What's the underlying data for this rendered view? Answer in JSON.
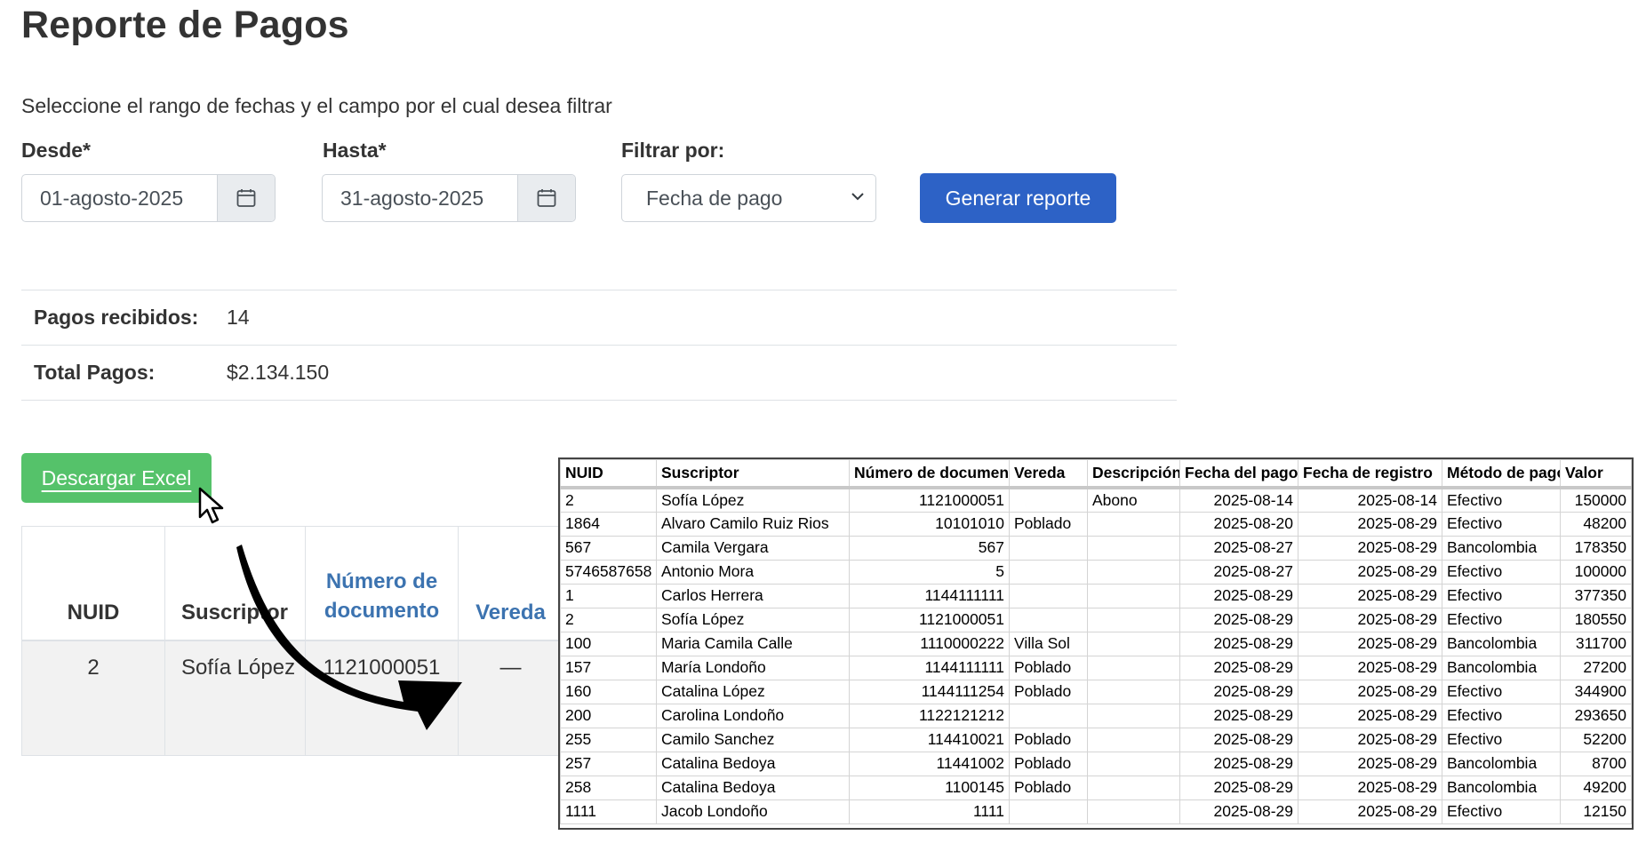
{
  "page": {
    "title": "Reporte de Pagos",
    "instructions": "Seleccione el rango de fechas y el campo por el cual desea filtrar"
  },
  "filters": {
    "desde_label": "Desde*",
    "desde_value": "01-agosto-2025",
    "hasta_label": "Hasta*",
    "hasta_value": "31-agosto-2025",
    "filtrar_label": "Filtrar por:",
    "filtrar_value": "Fecha de pago",
    "generate_button": "Generar reporte"
  },
  "summary": {
    "pagos_label": "Pagos recibidos:",
    "pagos_value": "14",
    "total_label": "Total Pagos:",
    "total_value": "$2.134.150"
  },
  "download_button": "Descargar Excel",
  "results_table": {
    "headers": [
      "NUID",
      "Suscriptor",
      "Número de documento",
      "Vereda"
    ],
    "row": {
      "nuid": "2",
      "suscriptor": "Sofía López",
      "documento": "1121000051",
      "vereda": "—"
    }
  },
  "excel_sheet": {
    "headers": [
      "NUID",
      "Suscriptor",
      "Número de documento",
      "Vereda",
      "Descripción",
      "Fecha del pago",
      "Fecha de registro",
      "Método de pago",
      "Valor"
    ],
    "rows": [
      [
        "2",
        "Sofía López",
        "1121000051",
        "",
        "Abono",
        "2025-08-14",
        "2025-08-14",
        "Efectivo",
        "150000"
      ],
      [
        "1864",
        "Alvaro Camilo Ruiz Rios",
        "10101010",
        "Poblado",
        "",
        "2025-08-20",
        "2025-08-29",
        "Efectivo",
        "48200"
      ],
      [
        "567",
        "Camila Vergara",
        "567",
        "",
        "",
        "2025-08-27",
        "2025-08-29",
        "Bancolombia",
        "178350"
      ],
      [
        "5746587658",
        "Antonio Mora",
        "5",
        "",
        "",
        "2025-08-27",
        "2025-08-29",
        "Efectivo",
        "100000"
      ],
      [
        "1",
        "Carlos Herrera",
        "1144111111",
        "",
        "",
        "2025-08-29",
        "2025-08-29",
        "Efectivo",
        "377350"
      ],
      [
        "2",
        "Sofía López",
        "1121000051",
        "",
        "",
        "2025-08-29",
        "2025-08-29",
        "Efectivo",
        "180550"
      ],
      [
        "100",
        "Maria Camila Calle",
        "1110000222",
        "Villa Sol",
        "",
        "2025-08-29",
        "2025-08-29",
        "Bancolombia",
        "311700"
      ],
      [
        "157",
        "María Londoño",
        "1144111111",
        "Poblado",
        "",
        "2025-08-29",
        "2025-08-29",
        "Bancolombia",
        "27200"
      ],
      [
        "160",
        "Catalina López",
        "1144111254",
        "Poblado",
        "",
        "2025-08-29",
        "2025-08-29",
        "Efectivo",
        "344900"
      ],
      [
        "200",
        "Carolina Londoño",
        "1122121212",
        "",
        "",
        "2025-08-29",
        "2025-08-29",
        "Efectivo",
        "293650"
      ],
      [
        "255",
        "Camilo Sanchez",
        "114410021",
        "Poblado",
        "",
        "2025-08-29",
        "2025-08-29",
        "Efectivo",
        "52200"
      ],
      [
        "257",
        "Catalina Bedoya",
        "11441002",
        "Poblado",
        "",
        "2025-08-29",
        "2025-08-29",
        "Bancolombia",
        "8700"
      ],
      [
        "258",
        "Catalina Bedoya",
        "1100145",
        "Poblado",
        "",
        "2025-08-29",
        "2025-08-29",
        "Bancolombia",
        "49200"
      ],
      [
        "1111",
        "Jacob Londoño",
        "1111",
        "",
        "",
        "2025-08-29",
        "2025-08-29",
        "Efectivo",
        "12150"
      ]
    ]
  },
  "colors": {
    "primary": "#2d62c6",
    "success": "#55c26a",
    "link": "#3c73b0"
  }
}
